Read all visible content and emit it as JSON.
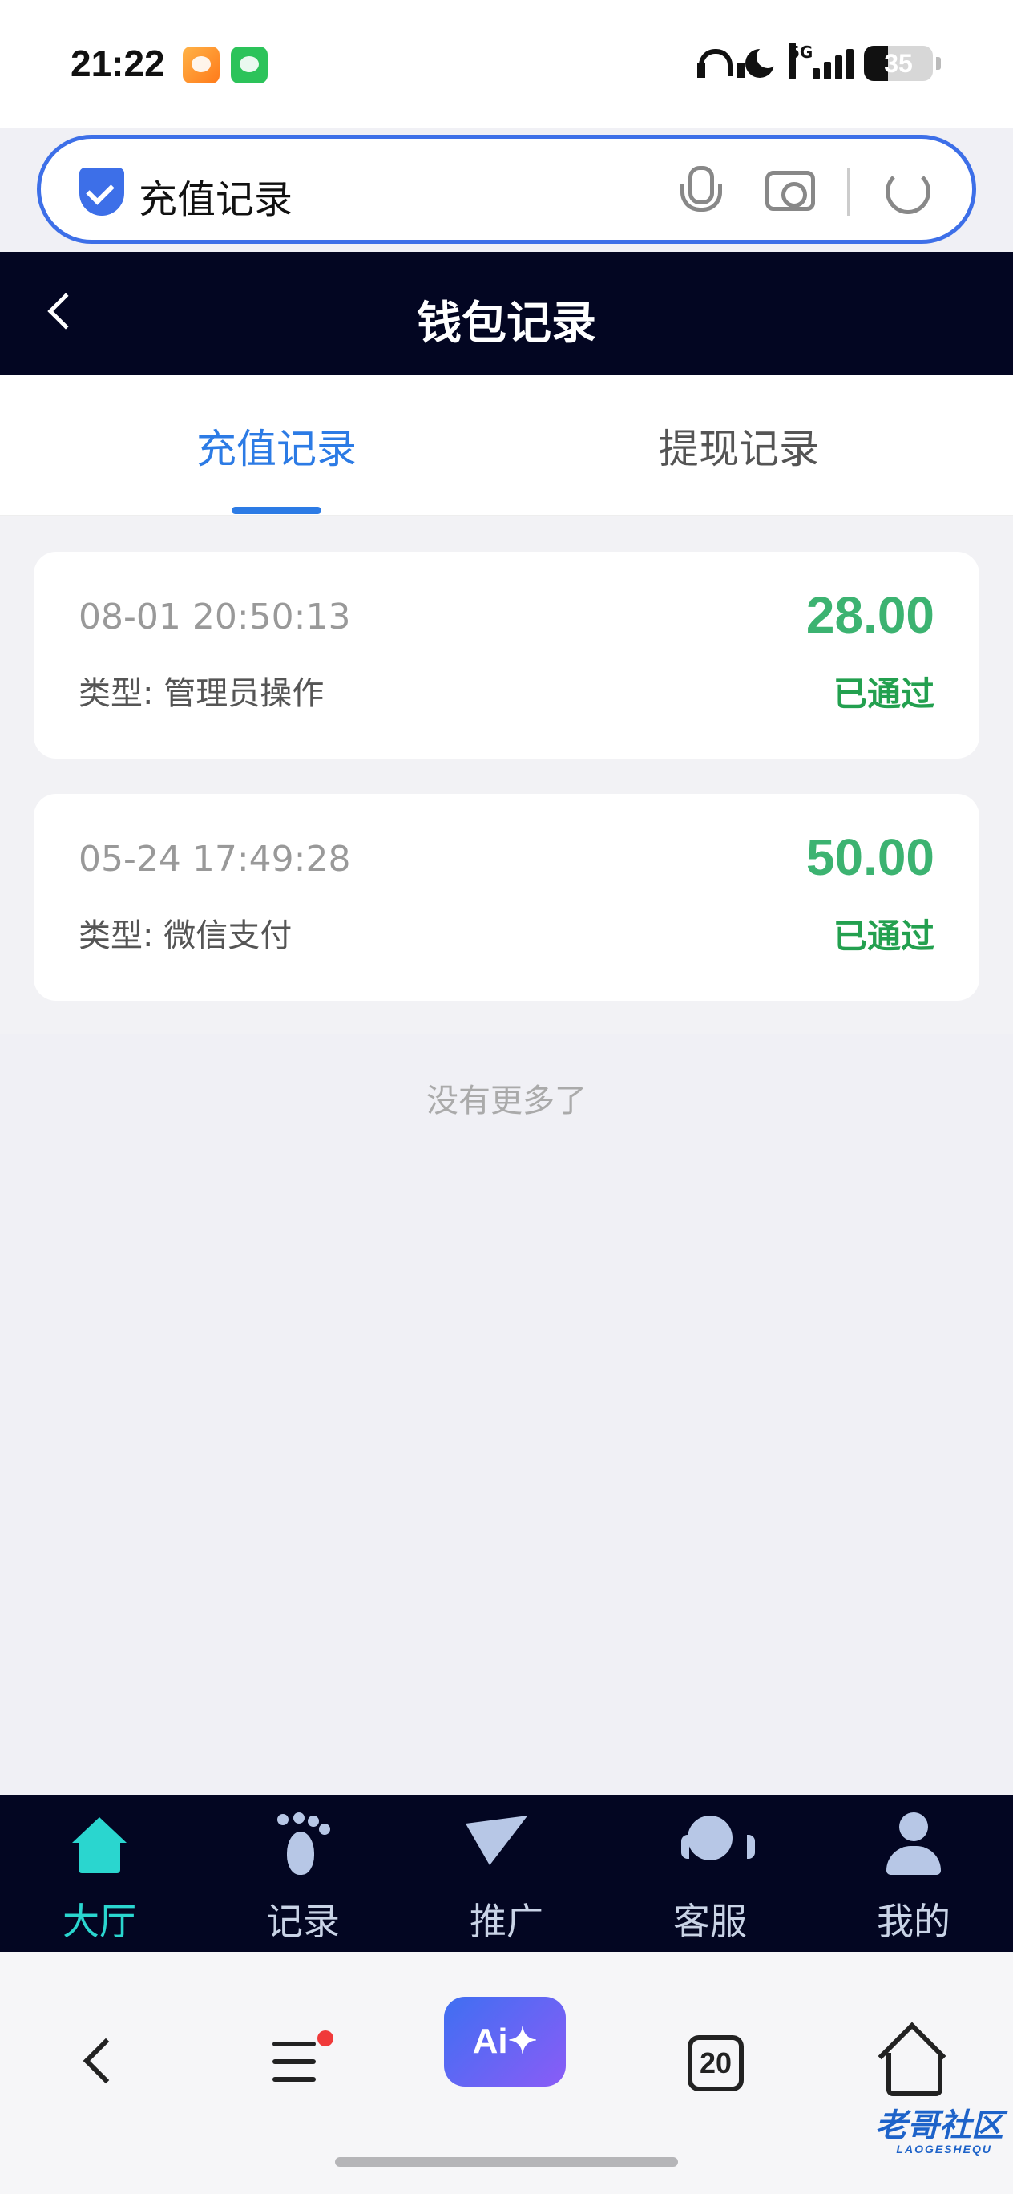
{
  "status_bar": {
    "time": "21:22",
    "network": "5G",
    "battery": "35",
    "battery_level": 0.35
  },
  "browser": {
    "address_text": "充值记录"
  },
  "header": {
    "title": "钱包记录"
  },
  "tabs": [
    {
      "label": "充值记录",
      "active": true
    },
    {
      "label": "提现记录",
      "active": false
    }
  ],
  "records": [
    {
      "time": "08-01 20:50:13",
      "type": "类型: 管理员操作",
      "amount": "28.00",
      "status": "已通过"
    },
    {
      "time": "05-24 17:49:28",
      "type": "类型: 微信支付",
      "amount": "50.00",
      "status": "已通过"
    }
  ],
  "list_footer": "没有更多了",
  "bottom_nav": [
    {
      "label": "大厅",
      "icon": "home-icon",
      "active": true
    },
    {
      "label": "记录",
      "icon": "footprint-icon",
      "active": false
    },
    {
      "label": "推广",
      "icon": "paper-plane-icon",
      "active": false
    },
    {
      "label": "客服",
      "icon": "headset-icon",
      "active": false
    },
    {
      "label": "我的",
      "icon": "user-icon",
      "active": false
    }
  ],
  "browser_toolbar": {
    "ai_label": "Ai✦",
    "tab_count": "20"
  },
  "watermark": {
    "text": "老哥社区",
    "sub": "LAOGESHEQU"
  },
  "colors": {
    "accent_blue": "#2c7be5",
    "header_bg": "#030622",
    "amount_green": "#3cb371",
    "status_green": "#23a04f",
    "nav_active": "#2ad6cf"
  }
}
